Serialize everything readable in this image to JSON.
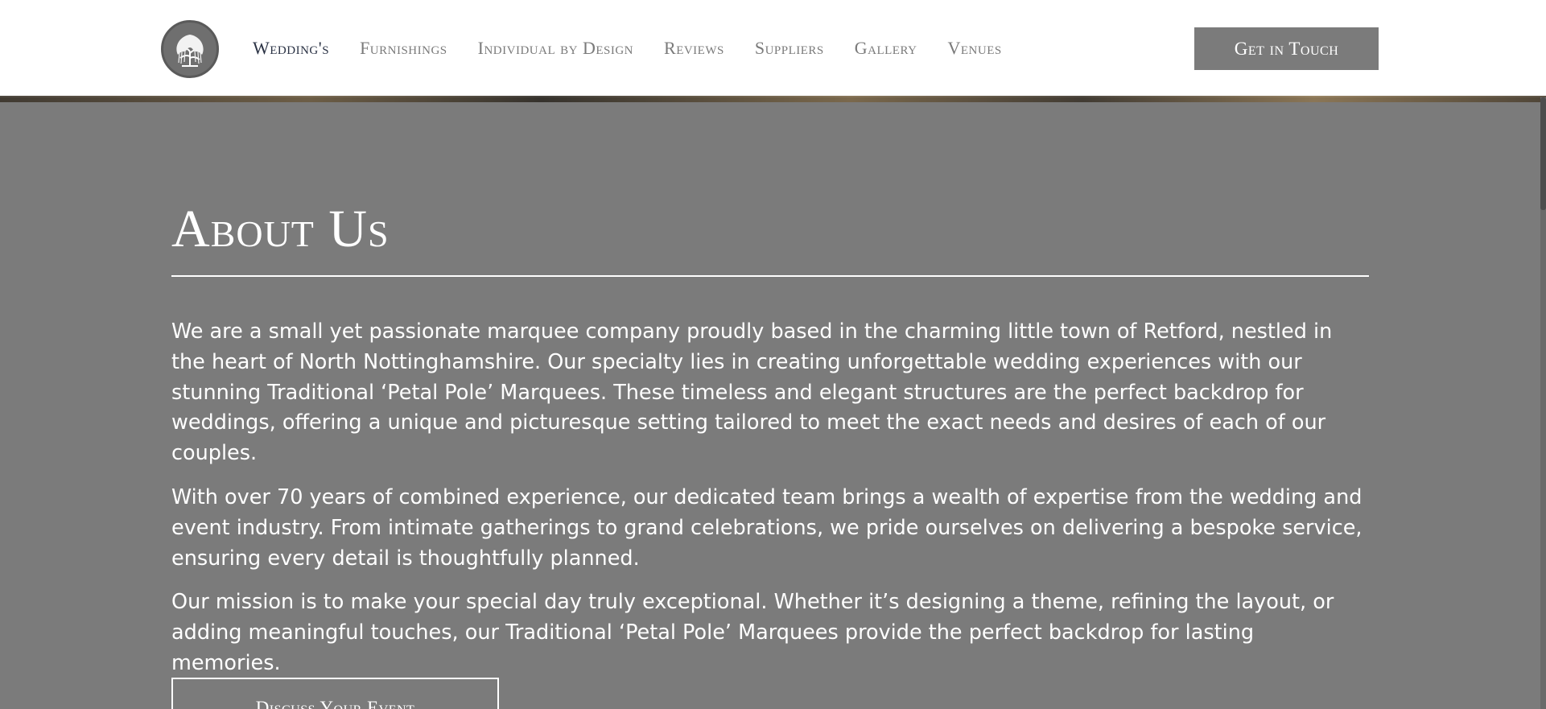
{
  "header": {
    "logo_icon": "willow-tree-icon",
    "nav": [
      {
        "label": "Wedding's",
        "active": true
      },
      {
        "label": "Furnishings"
      },
      {
        "label": "Individual by Design"
      },
      {
        "label": "Reviews"
      },
      {
        "label": "Suppliers"
      },
      {
        "label": "Gallery"
      },
      {
        "label": "Venues"
      }
    ],
    "cta_label": "Get in Touch"
  },
  "about": {
    "title": "About Us",
    "paragraphs": [
      "We are a small yet passionate marquee company proudly based in the charming little town of Retford, nestled in the heart of North Nottinghamshire. Our specialty lies in creating unforgettable wedding experiences with our stunning Traditional ‘Petal Pole’ Marquees. These timeless and elegant structures are the perfect backdrop for weddings, offering a unique and picturesque setting tailored to meet the exact needs and desires of each of our couples.",
      "With over 70 years of combined experience, our dedicated team brings a wealth of expertise from the wedding and event industry. From intimate gatherings to grand celebrations, we pride ourselves on delivering a bespoke service, ensuring every detail is thoughtfully planned.",
      "Our mission is to make your special day truly exceptional. Whether it’s designing a theme, refining the layout, or adding meaningful touches, our Traditional ‘Petal Pole’ Marquees provide the perfect backdrop for lasting memories."
    ],
    "button_label": "Discuss Your Event"
  },
  "colors": {
    "background": "#7b7b7b",
    "header_bg": "#ffffff",
    "nav_active": "#2a3244",
    "nav_text": "#7a7a7a",
    "text_light": "#ffffff"
  }
}
